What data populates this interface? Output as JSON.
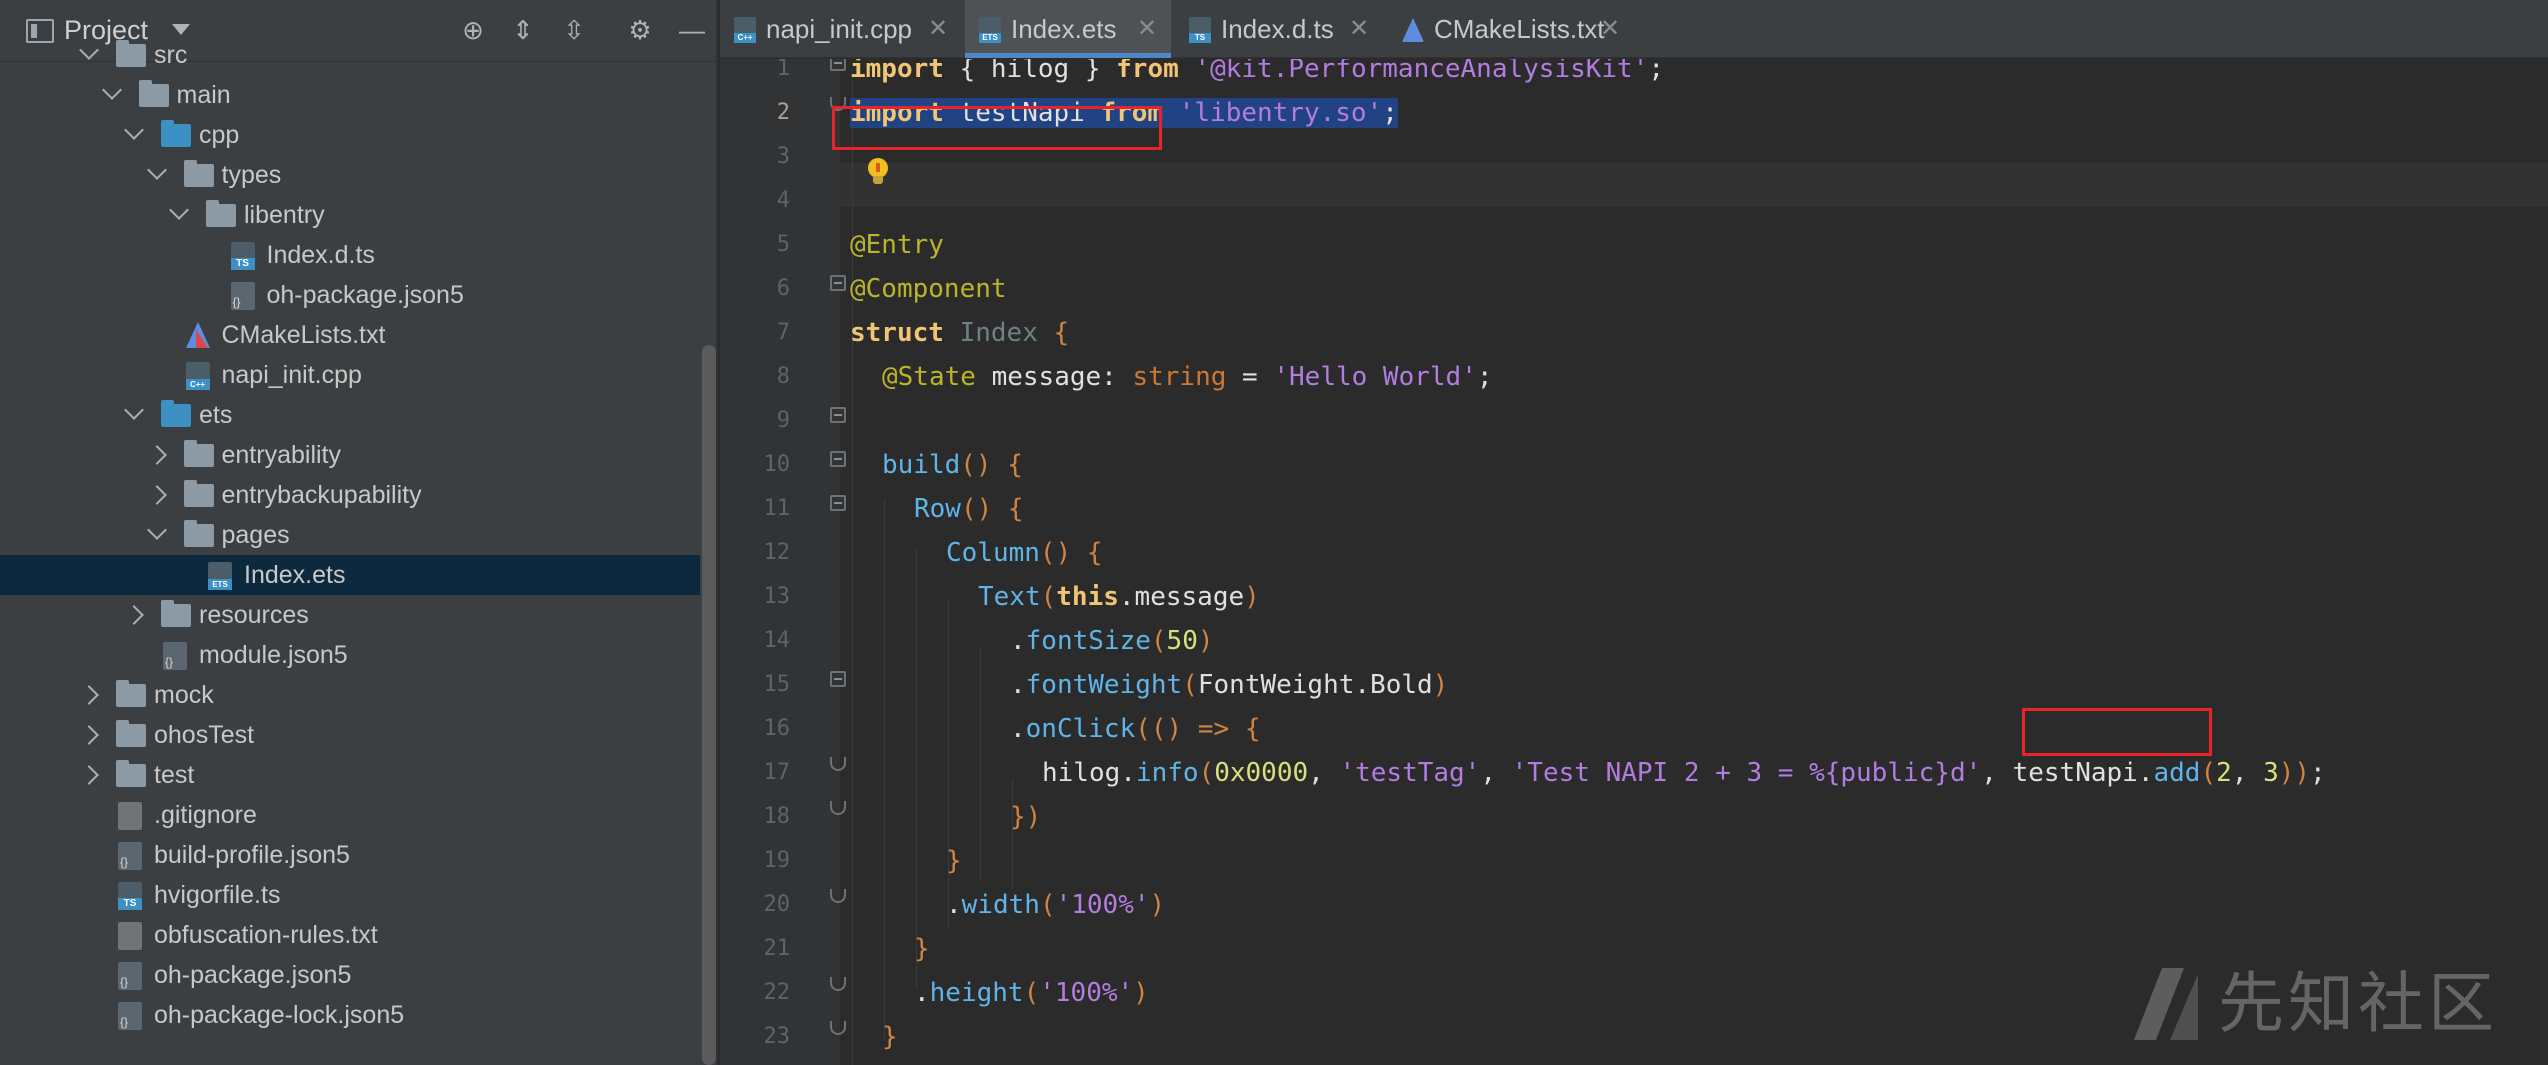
{
  "sidebar": {
    "title": "Project",
    "tree": [
      {
        "label": "src",
        "kind": "folder",
        "expanded": true
      },
      {
        "label": "main",
        "kind": "folder",
        "expanded": true
      },
      {
        "label": "cpp",
        "kind": "folder-blue",
        "expanded": true
      },
      {
        "label": "types",
        "kind": "folder",
        "expanded": true
      },
      {
        "label": "libentry",
        "kind": "folder",
        "expanded": true
      },
      {
        "label": "Index.d.ts",
        "kind": "file-ts"
      },
      {
        "label": "oh-package.json5",
        "kind": "file-json"
      },
      {
        "label": "CMakeLists.txt",
        "kind": "file-cmake"
      },
      {
        "label": "napi_init.cpp",
        "kind": "file-cpp"
      },
      {
        "label": "ets",
        "kind": "folder-blue",
        "expanded": true
      },
      {
        "label": "entryability",
        "kind": "folder",
        "expanded": false
      },
      {
        "label": "entrybackupability",
        "kind": "folder",
        "expanded": false
      },
      {
        "label": "pages",
        "kind": "folder",
        "expanded": true
      },
      {
        "label": "Index.ets",
        "kind": "file-ets",
        "selected": true
      },
      {
        "label": "resources",
        "kind": "folder",
        "expanded": false
      },
      {
        "label": "module.json5",
        "kind": "file-json"
      },
      {
        "label": "mock",
        "kind": "folder",
        "expanded": false
      },
      {
        "label": "ohosTest",
        "kind": "folder",
        "expanded": false
      },
      {
        "label": "test",
        "kind": "folder",
        "expanded": false
      },
      {
        "label": ".gitignore",
        "kind": "file-txt"
      },
      {
        "label": "build-profile.json5",
        "kind": "file-json"
      },
      {
        "label": "hvigorfile.ts",
        "kind": "file-ts"
      },
      {
        "label": "obfuscation-rules.txt",
        "kind": "file-txt"
      },
      {
        "label": "oh-package.json5",
        "kind": "file-json"
      },
      {
        "label": "oh-package-lock.json5",
        "kind": "file-json"
      }
    ]
  },
  "tabs": [
    {
      "label": "napi_init.cpp",
      "icon": "cpp-file-icon",
      "active": false
    },
    {
      "label": "Index.ets",
      "icon": "ets-file-icon",
      "active": true
    },
    {
      "label": "Index.d.ts",
      "icon": "ts-file-icon",
      "active": false
    },
    {
      "label": "CMakeLists.txt",
      "icon": "cmake-icon",
      "active": false
    }
  ],
  "editor": {
    "current_line": 2,
    "line_numbers": [
      "1",
      "2",
      "3",
      "4",
      "5",
      "6",
      "7",
      "8",
      "9",
      "10",
      "11",
      "12",
      "13",
      "14",
      "15",
      "16",
      "17",
      "18",
      "19",
      "20",
      "21",
      "22",
      "23"
    ],
    "code": {
      "l1": [
        "import",
        " { ",
        "hilog",
        " } ",
        "from",
        " ",
        "'@kit.PerformanceAnalysisKit'",
        ";"
      ],
      "l2": [
        "import",
        " testNapi ",
        "from",
        " ",
        "'libentry.so'",
        ";"
      ],
      "l4": "@Entry",
      "l5": "@Component",
      "l6": [
        "struct",
        " ",
        "Index",
        " {"
      ],
      "l7": [
        "@State",
        " message: ",
        "string",
        " = ",
        "'Hello World'",
        ";"
      ],
      "l9": [
        "build",
        "()",
        " {"
      ],
      "l10": [
        "Row",
        "()",
        " {"
      ],
      "l11": [
        "Column",
        "()",
        " {"
      ],
      "l12": [
        "Text",
        "(",
        "this",
        ".message",
        ")"
      ],
      "l13": [
        ".",
        "fontSize",
        "(",
        "50",
        ")"
      ],
      "l14": [
        ".",
        "fontWeight",
        "(",
        "FontWeight.Bold",
        ")"
      ],
      "l15": [
        ".",
        "onClick",
        "((",
        ") => {"
      ],
      "l16": [
        "hilog",
        ".",
        "info",
        "(",
        "0x0000",
        ", ",
        "'testTag'",
        ", ",
        "'Test NAPI 2 + 3 = %{public}d'",
        ", ",
        "testNapi",
        ".",
        "add",
        "(",
        "2",
        ", ",
        "3",
        "))",
        ";"
      ],
      "l17": "})",
      "l18": "}",
      "l19": [
        ".",
        "width",
        "(",
        "'100%'",
        ")"
      ],
      "l20": "}",
      "l21": [
        ".",
        "height",
        "(",
        "'100%'",
        ")"
      ],
      "l22": "}",
      "l23": "}"
    }
  },
  "watermark": {
    "text": "先知社区"
  },
  "colors": {
    "accent": "#4a88c7",
    "highlight_box": "#e8242b",
    "selection": "#214283",
    "selected_tree_row": "#0d293e"
  }
}
